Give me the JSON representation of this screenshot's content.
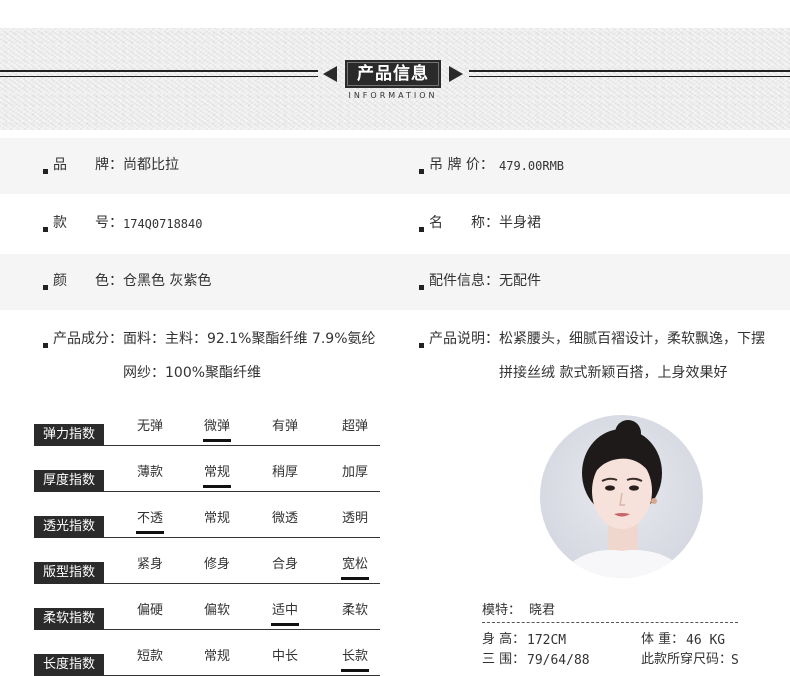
{
  "header": {
    "title": "产品信息",
    "subtitle": "INFORMATION"
  },
  "info": {
    "brand_label": "品　　牌：",
    "brand_value": "尚都比拉",
    "price_label": "吊 牌 价：",
    "price_value": "479.00RMB",
    "sku_label": "款　　号：",
    "sku_value": "174Q0718840",
    "name_label": "名　　称：",
    "name_value": "半身裙",
    "color_label": "颜　　色：",
    "color_value": "仓黑色 灰紫色",
    "accessory_label": "配件信息：",
    "accessory_value": "无配件",
    "composition_label": "产品成分：",
    "composition_line1": "面料：主料：92.1%聚酯纤维 7.9%氨纶",
    "composition_line2": "网纱：100%聚酯纤维",
    "desc_label": "产品说明：",
    "desc_line1": "松紧腰头，细腻百褶设计，柔软飘逸，下摆",
    "desc_line2": "拼接丝绒 款式新颖百搭，上身效果好"
  },
  "indices": [
    {
      "label": "弹力指数",
      "options": [
        "无弹",
        "微弹",
        "有弹",
        "超弹"
      ],
      "selected": 1
    },
    {
      "label": "厚度指数",
      "options": [
        "薄款",
        "常规",
        "稍厚",
        "加厚"
      ],
      "selected": 1
    },
    {
      "label": "透光指数",
      "options": [
        "不透",
        "常规",
        "微透",
        "透明"
      ],
      "selected": 0
    },
    {
      "label": "版型指数",
      "options": [
        "紧身",
        "修身",
        "合身",
        "宽松"
      ],
      "selected": 3
    },
    {
      "label": "柔软指数",
      "options": [
        "偏硬",
        "偏软",
        "适中",
        "柔软"
      ],
      "selected": 2
    },
    {
      "label": "长度指数",
      "options": [
        "短款",
        "常规",
        "中长",
        "长款"
      ],
      "selected": 3
    }
  ],
  "model": {
    "name_label": "模特：",
    "name_value": "晓君",
    "height_label": "身 高：",
    "height_value": "172CM",
    "weight_label": "体 重：",
    "weight_value": "46 KG",
    "measure_label": "三 围：",
    "measure_value": "79/64/88",
    "size_label": "此款所穿尺码：",
    "size_value": "S"
  },
  "colors": {
    "dark": "#2b2b2b",
    "row_shade": "#f5f5f5",
    "text": "#333333"
  }
}
